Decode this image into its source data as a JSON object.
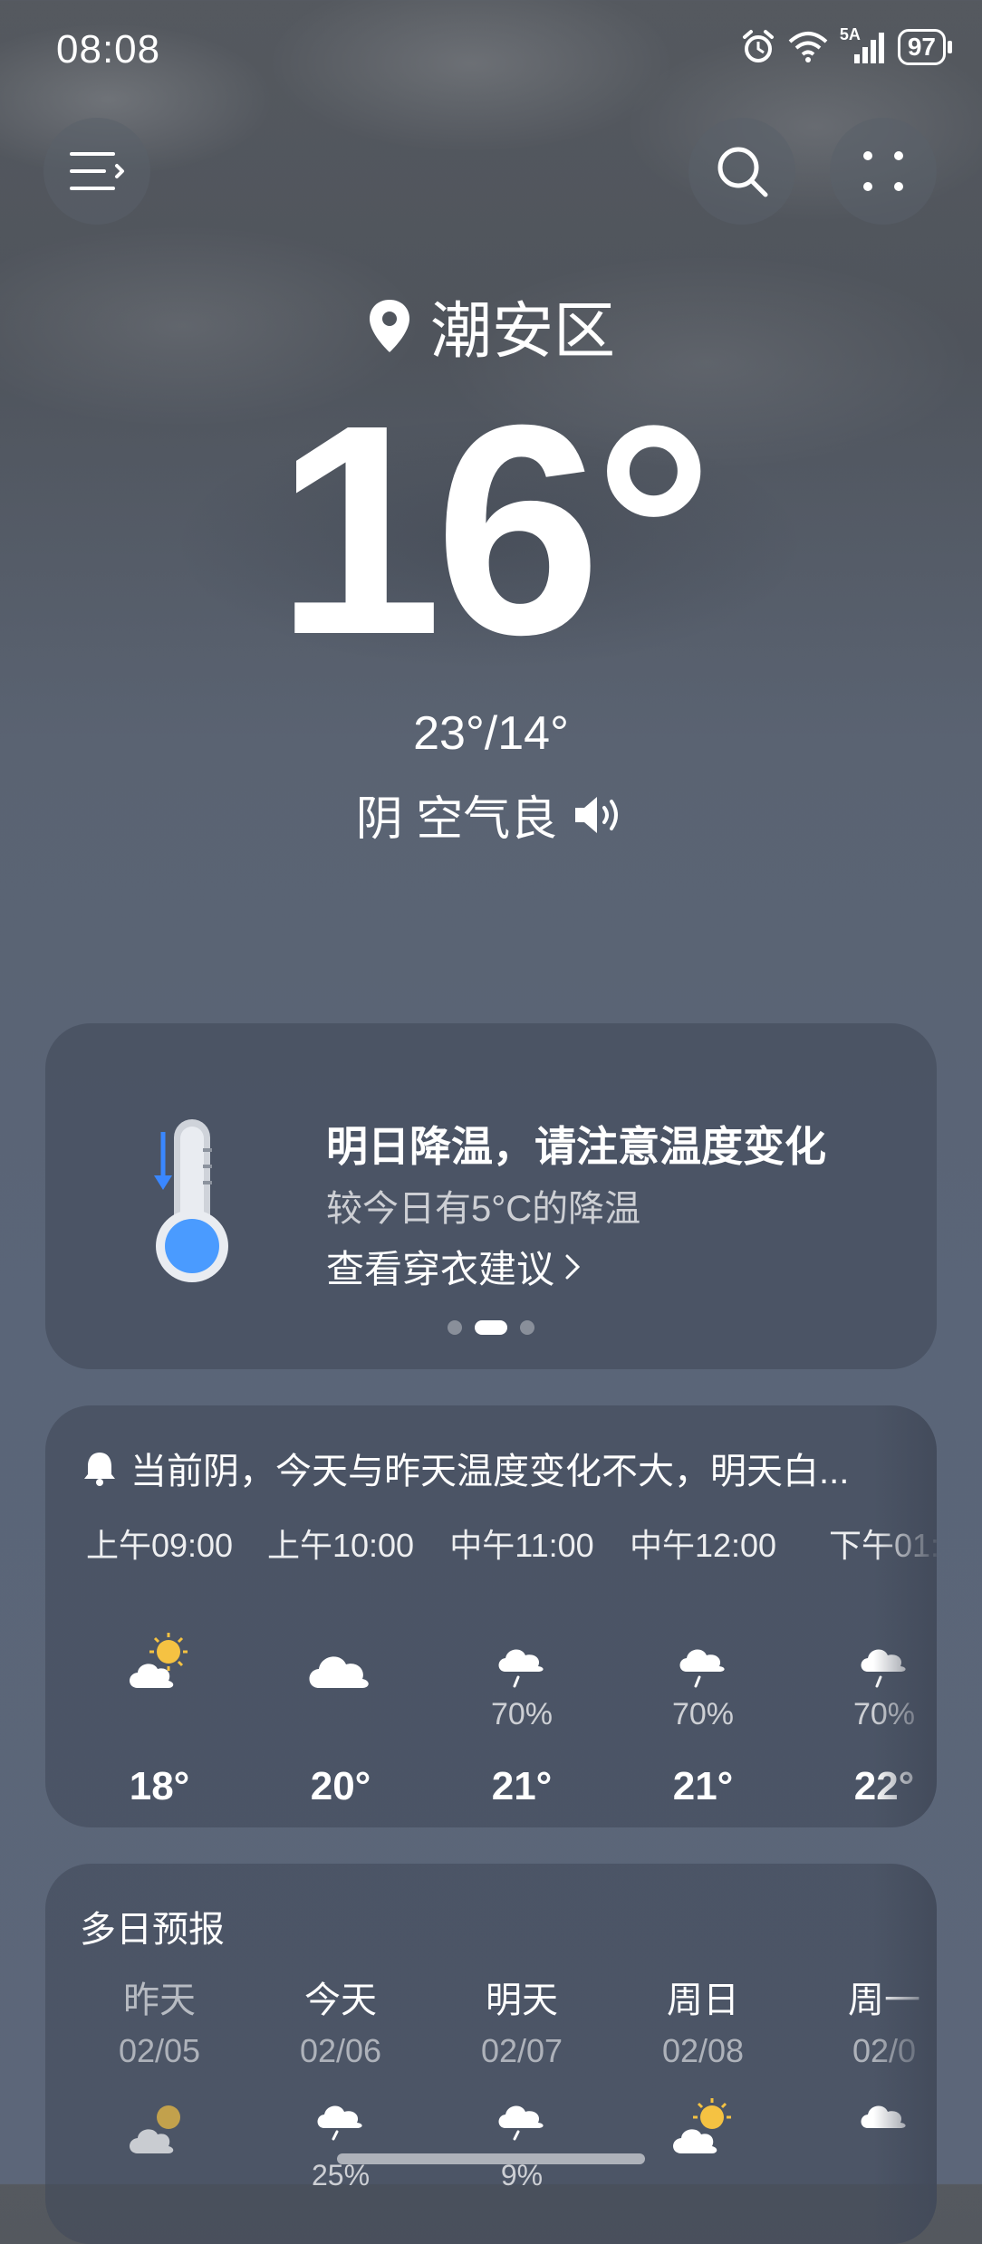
{
  "status_bar": {
    "time": "08:08",
    "network": "5A",
    "battery": "97"
  },
  "location": {
    "name": "潮安区"
  },
  "current": {
    "temperature": "16°",
    "high_low": "23°/14°",
    "condition": "阴 空气良"
  },
  "alert_card": {
    "title": "明日降温，请注意温度变化",
    "subtitle": "较今日有5°C的降温",
    "link": "查看穿衣建议"
  },
  "hourly": {
    "summary": "当前阴，今天与昨天温度变化不大，明天白...",
    "items": [
      {
        "time": "上午09:00",
        "icon": "sun-cloud-icon",
        "prob": "",
        "temp": "18°"
      },
      {
        "time": "上午10:00",
        "icon": "cloud-icon",
        "prob": "",
        "temp": "20°"
      },
      {
        "time": "中午11:00",
        "icon": "cloud-rain-icon",
        "prob": "70%",
        "temp": "21°"
      },
      {
        "time": "中午12:00",
        "icon": "cloud-rain-icon",
        "prob": "70%",
        "temp": "21°"
      },
      {
        "time": "下午01:",
        "icon": "cloud-rain-icon",
        "prob": "70%",
        "temp": "22°"
      }
    ]
  },
  "multi_day": {
    "title": "多日预报",
    "items": [
      {
        "day": "昨天",
        "date": "02/05",
        "icon": "sun-cloud-icon",
        "prob": ""
      },
      {
        "day": "今天",
        "date": "02/06",
        "icon": "cloud-rain-icon",
        "prob": "25%"
      },
      {
        "day": "明天",
        "date": "02/07",
        "icon": "cloud-rain-icon",
        "prob": "9%"
      },
      {
        "day": "周日",
        "date": "02/08",
        "icon": "sun-cloud-icon",
        "prob": ""
      },
      {
        "day": "周一",
        "date": "02/0",
        "icon": "cloud-rain-icon",
        "prob": ""
      }
    ]
  }
}
